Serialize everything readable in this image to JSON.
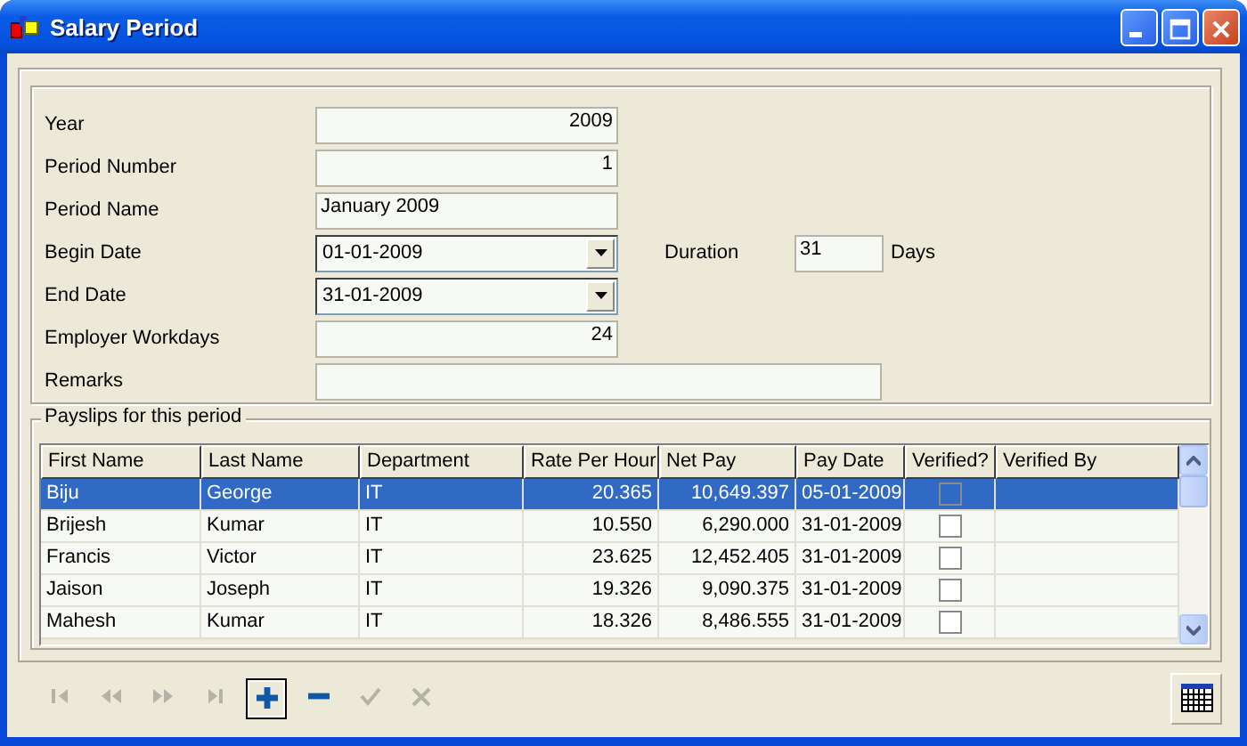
{
  "window": {
    "title": "Salary Period"
  },
  "form": {
    "fields": [
      {
        "label": "Year",
        "kind": "number",
        "value": "2009"
      },
      {
        "label": "Period Number",
        "kind": "number",
        "value": "1"
      },
      {
        "label": "Period Name",
        "kind": "text",
        "value": "January 2009"
      },
      {
        "label": "Begin Date",
        "kind": "date",
        "value": "01-01-2009",
        "side": {
          "label": "Duration",
          "value": "31",
          "unit": "Days"
        }
      },
      {
        "label": "End Date",
        "kind": "date",
        "value": "31-01-2009"
      },
      {
        "label": "Employer Workdays",
        "kind": "number",
        "value": "24"
      },
      {
        "label": "Remarks",
        "kind": "wide"
      }
    ]
  },
  "payslips": {
    "title": "Payslips for this period",
    "columns": [
      {
        "label": "First Name",
        "kind": "text"
      },
      {
        "label": "Last Name",
        "kind": "text"
      },
      {
        "label": "Department",
        "kind": "text"
      },
      {
        "label": "Rate Per Hour",
        "kind": "number"
      },
      {
        "label": "Net Pay",
        "kind": "number"
      },
      {
        "label": "Pay Date",
        "kind": "text"
      },
      {
        "label": "Verified?",
        "kind": "check"
      },
      {
        "label": "Verified By",
        "kind": "text"
      }
    ],
    "rows": [
      {
        "selected": true,
        "cells": [
          "Biju",
          "George",
          "IT",
          "20.365",
          "10,649.397",
          "05-01-2009"
        ],
        "verified": false
      },
      {
        "selected": false,
        "cells": [
          "Brijesh",
          "Kumar",
          "IT",
          "10.550",
          "6,290.000",
          "31-01-2009"
        ],
        "verified": false
      },
      {
        "selected": false,
        "cells": [
          "Francis",
          "Victor",
          "IT",
          "23.625",
          "12,452.405",
          "31-01-2009"
        ],
        "verified": false
      },
      {
        "selected": false,
        "cells": [
          "Jaison",
          "Joseph",
          "IT",
          "19.326",
          "9,090.375",
          "31-01-2009"
        ],
        "verified": false
      },
      {
        "selected": false,
        "cells": [
          "Mahesh",
          "Kumar",
          "IT",
          "18.326",
          "8,486.555",
          "31-01-2009"
        ],
        "verified": false
      }
    ]
  },
  "toolbar": [
    {
      "kind": "first",
      "disabled": true,
      "focused": false
    },
    {
      "kind": "prev",
      "disabled": true,
      "focused": false
    },
    {
      "kind": "next",
      "disabled": true,
      "focused": false
    },
    {
      "kind": "last",
      "disabled": true,
      "focused": false
    },
    {
      "kind": "add",
      "disabled": false,
      "focused": true
    },
    {
      "kind": "remove",
      "disabled": false,
      "focused": false
    },
    {
      "kind": "accept",
      "disabled": true,
      "focused": false
    },
    {
      "kind": "cancel",
      "disabled": true,
      "focused": false
    }
  ]
}
